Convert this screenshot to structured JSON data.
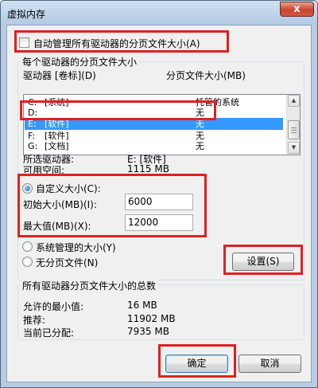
{
  "window": {
    "title": "虚拟内存",
    "close_glyph": "x"
  },
  "auto_manage": {
    "label": "自动管理所有驱动器的分页文件大小(A)",
    "checked": false
  },
  "drives_group": {
    "legend": "每个驱动器的分页文件大小",
    "col_drive": "驱动器 [卷标](D)",
    "col_size": "分页文件大小(MB)",
    "rows": [
      {
        "drive": "C:",
        "label": "[系统]",
        "size": "托管的系统",
        "selected": false
      },
      {
        "drive": "D:",
        "label": "",
        "size": "无",
        "selected": false
      },
      {
        "drive": "E:",
        "label": "[软件]",
        "size": "无",
        "selected": true
      },
      {
        "drive": "F:",
        "label": "[软件]",
        "size": "无",
        "selected": false
      },
      {
        "drive": "G:",
        "label": "[文档]",
        "size": "无",
        "selected": false
      }
    ],
    "selected_drive_label": "所选驱动器:",
    "selected_drive_value": "E:  [软件]",
    "free_space_label": "可用空间:",
    "free_space_value": "1115 MB",
    "custom_size_label": "自定义大小(C):",
    "initial_size_label": "初始大小(MB)(I):",
    "initial_size_value": "6000",
    "max_size_label": "最大值(MB)(X):",
    "max_size_value": "12000",
    "system_managed_label": "系统管理的大小(Y)",
    "no_paging_label": "无分页文件(N)",
    "set_button": "设置(S)"
  },
  "totals_group": {
    "legend": "所有驱动器分页文件大小的总数",
    "min_label": "允许的最小值:",
    "min_value": "16 MB",
    "recommended_label": "推荐:",
    "recommended_value": "11902 MB",
    "allocated_label": "当前已分配:",
    "allocated_value": "7935 MB"
  },
  "footer": {
    "ok_button": "确定",
    "cancel_button": "取消"
  },
  "colors": {
    "highlight": "#e02020",
    "selection": "#3399ff"
  }
}
